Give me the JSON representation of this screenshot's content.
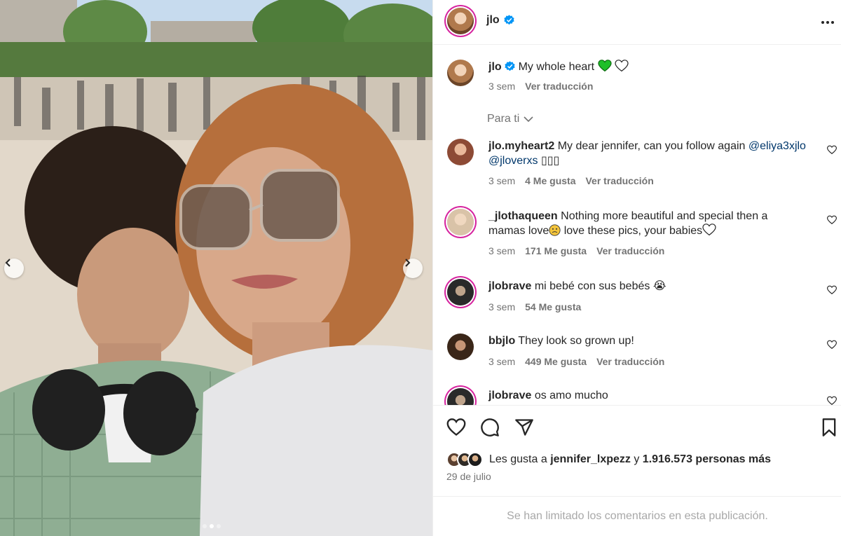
{
  "post": {
    "author": "jlo",
    "caption": "My whole heart",
    "caption_emoji": [
      "green-heart",
      "white-heart"
    ],
    "caption_time": "3 sem",
    "translate": "Ver traducción",
    "filter_label": "Para ti",
    "carousel": {
      "slides": 3,
      "active_slide": 2
    }
  },
  "comments": [
    {
      "user": "jlo.myheart2",
      "text": "My dear jennifer, can you follow again",
      "mentions": [
        "@eliya3xjlo",
        "@jloverxs"
      ],
      "trailing": "▯▯▯",
      "time": "3 sem",
      "likes": "4 Me gusta",
      "translate": "Ver traducción"
    },
    {
      "user": "_jlothaqueen",
      "text_line1": "Nothing more beautiful and special then a",
      "text_line2": "mamas love",
      "text_line2b": " love these pics, your babies",
      "time": "3 sem",
      "likes": "171 Me gusta",
      "translate": "Ver traducción"
    },
    {
      "user": "jlobrave",
      "text": "mi bebé con sus bebés",
      "emoji": "😭",
      "time": "3 sem",
      "likes": "54 Me gusta"
    },
    {
      "user": "bbjlo",
      "text": "They look so grown up!",
      "time": "3 sem",
      "likes": "449 Me gusta",
      "translate": "Ver traducción"
    },
    {
      "user": "jlobrave",
      "text": "os amo mucho"
    }
  ],
  "likes": {
    "prefix": "Les gusta a",
    "user": "jennifer_lxpezz",
    "connector": "y",
    "count": "1.916.573 personas más"
  },
  "date": "29 de julio",
  "comments_limited": "Se han limitado los comentarios en esta publicación.",
  "icons": {
    "more": "more-options-icon",
    "like": "heart-icon",
    "comment": "comment-icon",
    "share": "send-icon",
    "save": "bookmark-icon",
    "verified": "verified-badge-icon"
  },
  "colors": {
    "verified": "#0095f6",
    "mention": "#00376b",
    "meta": "#737373",
    "story_ring": "#d6249f"
  }
}
